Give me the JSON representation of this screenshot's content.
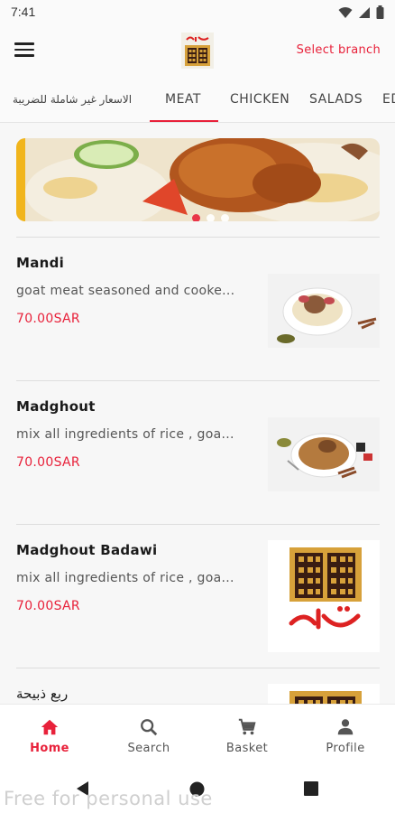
{
  "status": {
    "time": "7:41"
  },
  "appbar": {
    "select_branch": "Select branch"
  },
  "tabs": [
    {
      "label": "الاسعار غير شاملة للضريبة"
    },
    {
      "label": "MEAT"
    },
    {
      "label": "CHICKEN"
    },
    {
      "label": "SALADS"
    },
    {
      "label": "ED"
    }
  ],
  "active_tab": "MEAT",
  "banner": {
    "slides": 3,
    "active_slide": 1
  },
  "items": [
    {
      "name": "Mandi",
      "desc": "goat meat seasoned and cooke...",
      "price": "70.00SAR",
      "image": "mandi-dish"
    },
    {
      "name": "Madghout",
      "desc": "mix all ingredients of rice , goa...",
      "price": "70.00SAR",
      "image": "madghout-dish"
    },
    {
      "name": "Madghout Badawi",
      "desc": "mix all ingredients of rice , goa...",
      "price": "70.00SAR",
      "image": "restaurant-logo"
    },
    {
      "name": "ربع ذبيحة",
      "desc": "",
      "price": "",
      "image": "restaurant-logo"
    }
  ],
  "bottom_nav": [
    {
      "label": "Home",
      "icon": "home-icon",
      "active": true
    },
    {
      "label": "Search",
      "icon": "search-icon",
      "active": false
    },
    {
      "label": "Basket",
      "icon": "cart-icon",
      "active": false
    },
    {
      "label": "Profile",
      "icon": "person-icon",
      "active": false
    }
  ],
  "watermark": "Free for personal use",
  "colors": {
    "accent": "#e8213a",
    "background": "#f7f7f7"
  }
}
